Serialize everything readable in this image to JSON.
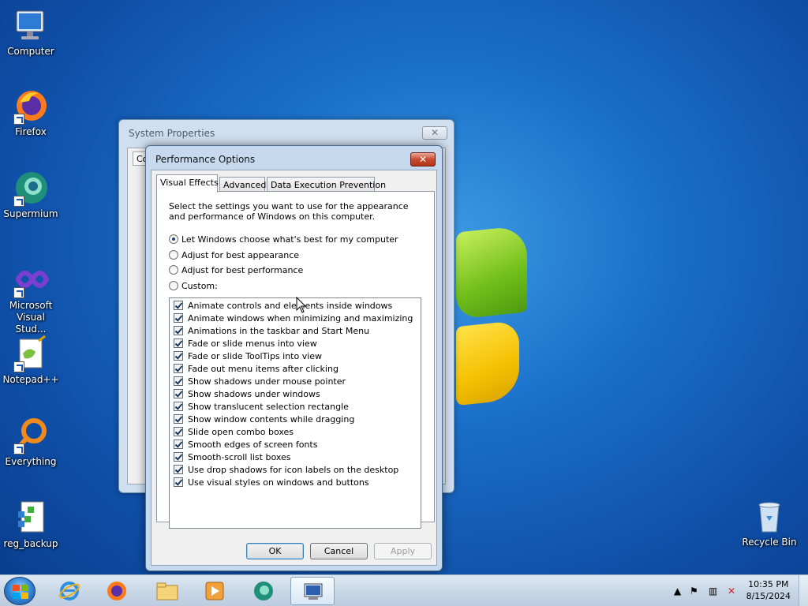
{
  "desktop": {
    "icons": [
      {
        "label": "Computer",
        "icon": "computer-icon"
      },
      {
        "label": "Firefox",
        "icon": "firefox-icon"
      },
      {
        "label": "Supermium",
        "icon": "supermium-icon"
      },
      {
        "label": "Microsoft Visual Stud...",
        "icon": "visual-studio-icon"
      },
      {
        "label": "Notepad++",
        "icon": "notepadpp-icon"
      },
      {
        "label": "Everything",
        "icon": "everything-icon"
      },
      {
        "label": "reg_backup",
        "icon": "registry-file-icon"
      },
      {
        "label": "Recycle Bin",
        "icon": "recycle-bin-icon"
      }
    ]
  },
  "system_properties": {
    "title": "System Properties",
    "close": "✕",
    "tab_stub": "Co"
  },
  "performance_options": {
    "title": "Performance Options",
    "close": "✕",
    "tabs": [
      "Visual Effects",
      "Advanced",
      "Data Execution Prevention"
    ],
    "active_tab": "Visual Effects",
    "description": "Select the settings you want to use for the appearance and performance of Windows on this computer.",
    "radios": [
      {
        "label": "Let Windows choose what's best for my computer",
        "selected": true
      },
      {
        "label": "Adjust for best appearance",
        "selected": false
      },
      {
        "label": "Adjust for best performance",
        "selected": false
      },
      {
        "label": "Custom:",
        "selected": false
      }
    ],
    "options": [
      {
        "label": "Animate controls and elements inside windows",
        "checked": true
      },
      {
        "label": "Animate windows when minimizing and maximizing",
        "checked": true
      },
      {
        "label": "Animations in the taskbar and Start Menu",
        "checked": true
      },
      {
        "label": "Fade or slide menus into view",
        "checked": true
      },
      {
        "label": "Fade or slide ToolTips into view",
        "checked": true
      },
      {
        "label": "Fade out menu items after clicking",
        "checked": true
      },
      {
        "label": "Show shadows under mouse pointer",
        "checked": true
      },
      {
        "label": "Show shadows under windows",
        "checked": true
      },
      {
        "label": "Show translucent selection rectangle",
        "checked": true
      },
      {
        "label": "Show window contents while dragging",
        "checked": true
      },
      {
        "label": "Slide open combo boxes",
        "checked": true
      },
      {
        "label": "Smooth edges of screen fonts",
        "checked": true
      },
      {
        "label": "Smooth-scroll list boxes",
        "checked": true
      },
      {
        "label": "Use drop shadows for icon labels on the desktop",
        "checked": true
      },
      {
        "label": "Use visual styles on windows and buttons",
        "checked": true
      }
    ],
    "buttons": {
      "ok": "OK",
      "cancel": "Cancel",
      "apply": "Apply"
    }
  },
  "taskbar": {
    "items": [
      "internet-explorer-icon",
      "firefox-icon",
      "explorer-folder-icon",
      "media-player-icon",
      "supermium-icon",
      "system-properties-icon"
    ],
    "tray": {
      "time": "10:35 PM",
      "date": "8/15/2024",
      "icons": [
        "show-hidden-icons-icon",
        "action-center-flag-icon",
        "network-icon",
        "volume-muted-icon"
      ]
    }
  }
}
